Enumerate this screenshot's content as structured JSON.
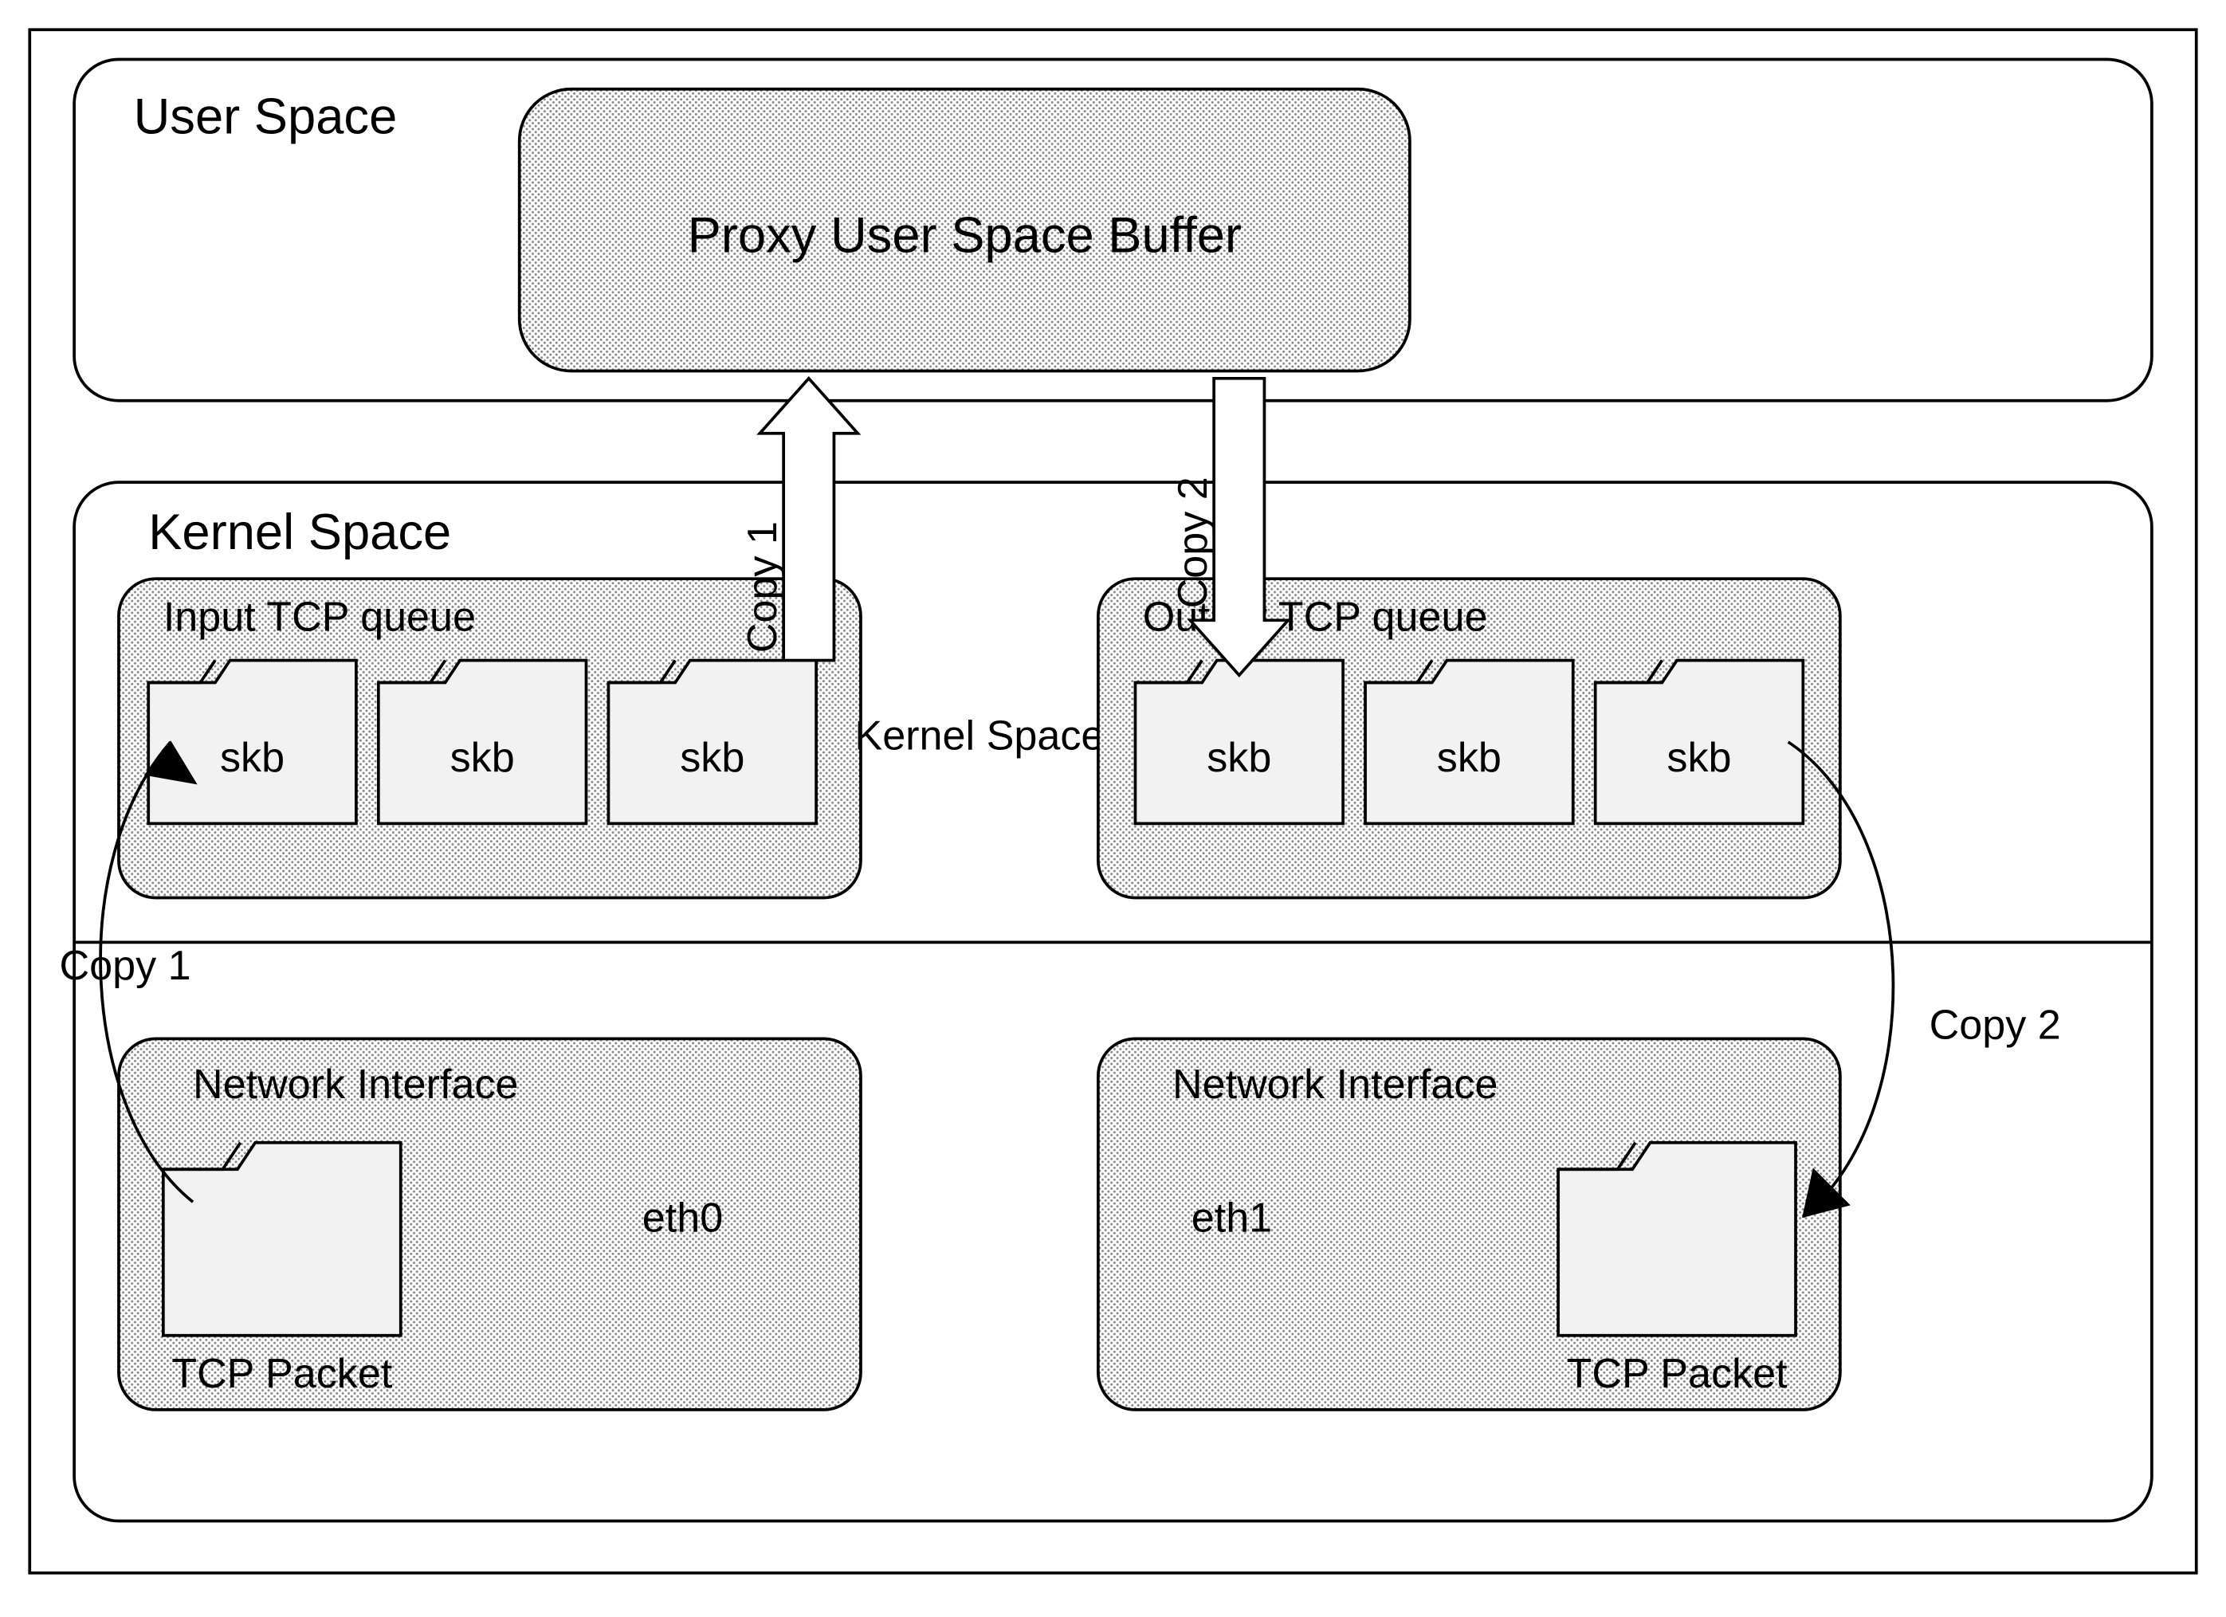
{
  "outer": {
    "label": ""
  },
  "userSpace": {
    "label": "User Space",
    "buffer": "Proxy User Space Buffer"
  },
  "centerLabel": "Kernel Space",
  "kernelSpace": {
    "label": "Kernel Space",
    "inputQueue": {
      "label": "Input TCP queue",
      "skb": [
        "skb",
        "skb",
        "skb"
      ]
    },
    "outputQueue": {
      "label": "Output TCP queue",
      "skb": [
        "skb",
        "skb",
        "skb"
      ]
    }
  },
  "nic0": {
    "label": "Network Interface",
    "iface": "eth0",
    "packet": "TCP Packet"
  },
  "nic1": {
    "label": "Network Interface",
    "iface": "eth1",
    "packet": "TCP Packet"
  },
  "arrows": {
    "copy1_v": "Copy 1",
    "copy2_v": "Copy 2",
    "copy1_ext": "Copy 1",
    "copy2_ext": "Copy 2"
  }
}
